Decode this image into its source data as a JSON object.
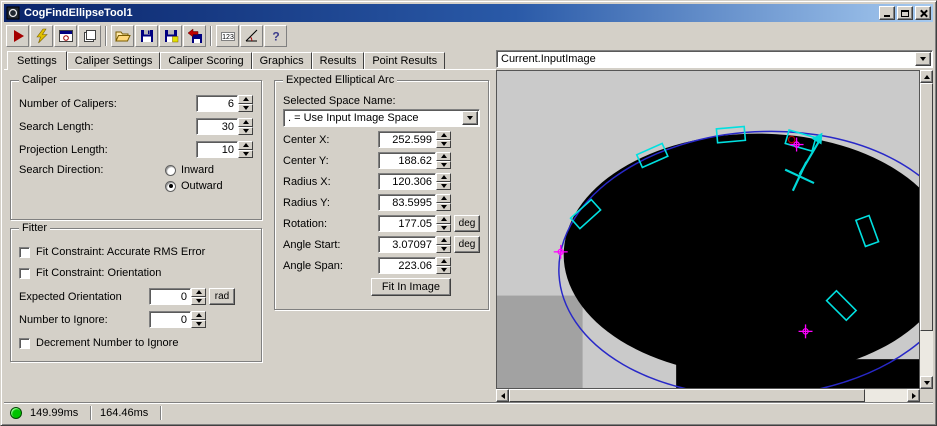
{
  "window": {
    "title": "CogFindEllipseTool1"
  },
  "toolbar": {
    "numeric_label": "123",
    "help_glyph": "?",
    "buttons": [
      "run",
      "electric-run",
      "current-image",
      "copy-results",
      "open-file",
      "save-file",
      "save-image",
      "import-file",
      "numeric-format",
      "slope",
      "help"
    ]
  },
  "tabs": {
    "items": [
      {
        "label": "Settings",
        "active": true
      },
      {
        "label": "Caliper Settings",
        "active": false
      },
      {
        "label": "Caliper Scoring",
        "active": false
      },
      {
        "label": "Graphics",
        "active": false
      },
      {
        "label": "Results",
        "active": false
      },
      {
        "label": "Point Results",
        "active": false
      }
    ]
  },
  "caliper": {
    "title": "Caliper",
    "rows": [
      {
        "label": "Number of Calipers:",
        "value": "6"
      },
      {
        "label": "Search Length:",
        "value": "30"
      },
      {
        "label": "Projection Length:",
        "value": "10"
      }
    ],
    "direction": {
      "label": "Search Direction:",
      "inward": "Inward",
      "outward": "Outward",
      "selected": "Outward"
    }
  },
  "fitter": {
    "title": "Fitter",
    "cb_rms": {
      "label": "Fit Constraint: Accurate RMS Error",
      "checked": false
    },
    "cb_orient": {
      "label": "Fit Constraint: Orientation",
      "checked": false
    },
    "expected_orientation": {
      "label": "Expected Orientation",
      "value": "0",
      "unit": "rad"
    },
    "number_to_ignore": {
      "label": "Number to Ignore:",
      "value": "0"
    },
    "cb_decrement": {
      "label": "Decrement Number to Ignore",
      "checked": false
    }
  },
  "arc": {
    "title": "Expected Elliptical Arc",
    "space_label": "Selected Space Name:",
    "space_value": ". = Use Input Image Space",
    "rows": [
      {
        "label": "Center X:",
        "value": "252.599"
      },
      {
        "label": "Center Y:",
        "value": "188.62"
      },
      {
        "label": "Radius X:",
        "value": "120.306"
      },
      {
        "label": "Radius Y:",
        "value": "83.5995"
      },
      {
        "label": "Rotation:",
        "value": "177.05",
        "unit": "deg"
      },
      {
        "label": "Angle Start:",
        "value": "3.07097",
        "unit": "deg"
      },
      {
        "label": "Angle Span:",
        "value": "223.06",
        "unit": "deg"
      }
    ],
    "fit_button": "Fit In Image"
  },
  "image_panel": {
    "source": "Current.InputImage"
  },
  "status": {
    "time1": "149.99ms",
    "time2": "164.46ms"
  },
  "colors": {
    "overlay_ellipse": "#2828c8",
    "caliper": "#00e0e0",
    "marker": "#ff00ff",
    "arrow": "#00d8d8",
    "found_point": "#aa0000",
    "status_ok": "#00c400"
  }
}
